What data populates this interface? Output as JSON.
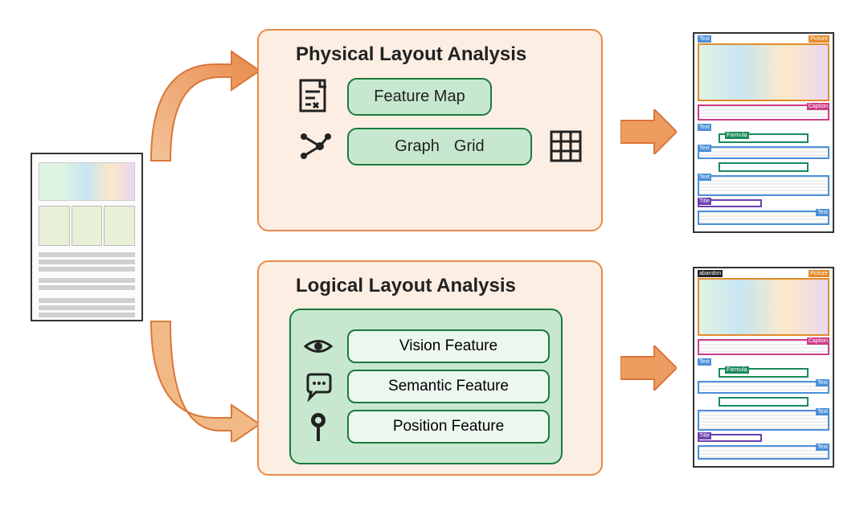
{
  "input": {
    "label": "document-page"
  },
  "physical": {
    "title": "Physical Layout Analysis",
    "feature_map": "Feature Map",
    "graph": "Graph",
    "grid": "Grid",
    "output_labels": {
      "text": "Text",
      "picture": "Picture",
      "caption": "Caption",
      "formula": "Formula",
      "title": "Title"
    }
  },
  "logical": {
    "title": "Logical Layout Analysis",
    "vision": "Vision Feature",
    "semantic": "Semantic Feature",
    "position": "Position Feature",
    "output_labels": {
      "abandon": "abandon",
      "picture": "Picture",
      "caption": "Caption",
      "text": "Text",
      "formula": "Formula",
      "title": "Title"
    }
  }
}
